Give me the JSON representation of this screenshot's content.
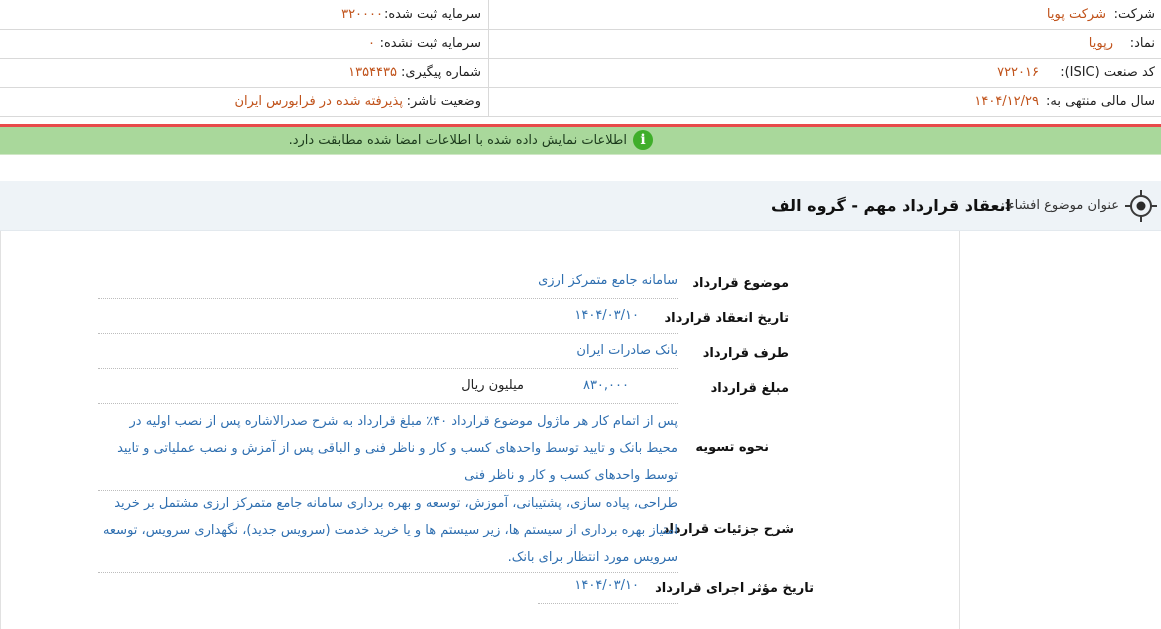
{
  "company": {
    "company_label": "شرکت:",
    "company_value": "شرکت پویا",
    "capital_label": "سرمایه ثبت شده:",
    "capital_value": "۳۲۰۰۰۰",
    "symbol_label": "نماد:",
    "symbol_value": "رپویا",
    "unregistered_label": "سرمایه ثبت نشده:",
    "unregistered_value": "۰",
    "isic_label": "کد صنعت (ISIC):",
    "isic_value": "۷۲۲۰۱۶",
    "tracking_label": "شماره پیگیری:",
    "tracking_value": "۱۳۵۴۴۳۵",
    "fiscal_label": "سال مالی منتهی به:",
    "fiscal_value": "۱۴۰۴/۱۲/۲۹",
    "status_label": "وضعیت ناشر:",
    "status_value": "پذیرفته شده در فرابورس ایران"
  },
  "notice": {
    "icon": "info-icon",
    "text": "اطلاعات نمایش داده شده با اطلاعات امضا شده مطابقت دارد."
  },
  "subject": {
    "label": "عنوان موضوع افشاء:",
    "title": "انعقاد قرارداد مهم - گروه الف"
  },
  "details": {
    "subject_label": "موضوع قرارداد",
    "subject_value": "سامانه جامع متمرکز ارزی",
    "date_label": "تاریخ انعقاد قرارداد",
    "date_value": "۱۴۰۴/۰۳/۱۰",
    "party_label": "طرف قرارداد",
    "party_value": "بانک صادرات ایران",
    "amount_label": "مبلغ قرارداد",
    "amount_value": "۸۳۰,۰۰۰",
    "amount_unit": "میلیون ریال",
    "settlement_label": "نحوه تسویه",
    "settlement_value": "پس از اتمام کار هر ماژول موضوع قرارداد ۴۰٪ مبلغ قرارداد به شرح صدرالاشاره پس از نصب اولیه در محیط بانک و تایید توسط واحدهای کسب و کار و ناظر فنی و الباقی پس از آمزش و نصب عملیاتی و تایید توسط واحدهای کسب و کار و ناظر فنی",
    "description_label": "شرح جزئیات قرارداد",
    "description_value": "طراحی، پیاده سازی، پشتیبانی، آموزش، توسعه و بهره برداری سامانه جامع متمرکز ارزی مشتمل بر خرید امتیاز بهره برداری از سیستم ها، زیر سیستم ها و یا خرید خدمت (سرویس جدید)، نگهداری سرویس، توسعه سرویس مورد انتظار برای بانک.",
    "effective_label": "تاریخ مؤثر اجرای قرارداد",
    "effective_value": "۱۴۰۴/۰۳/۱۰"
  },
  "colors": {
    "value_orange": "#c0521a",
    "value_blue": "#2f6fb0",
    "notice_green": "#a9d89b",
    "separator_red": "#e84a4a"
  }
}
